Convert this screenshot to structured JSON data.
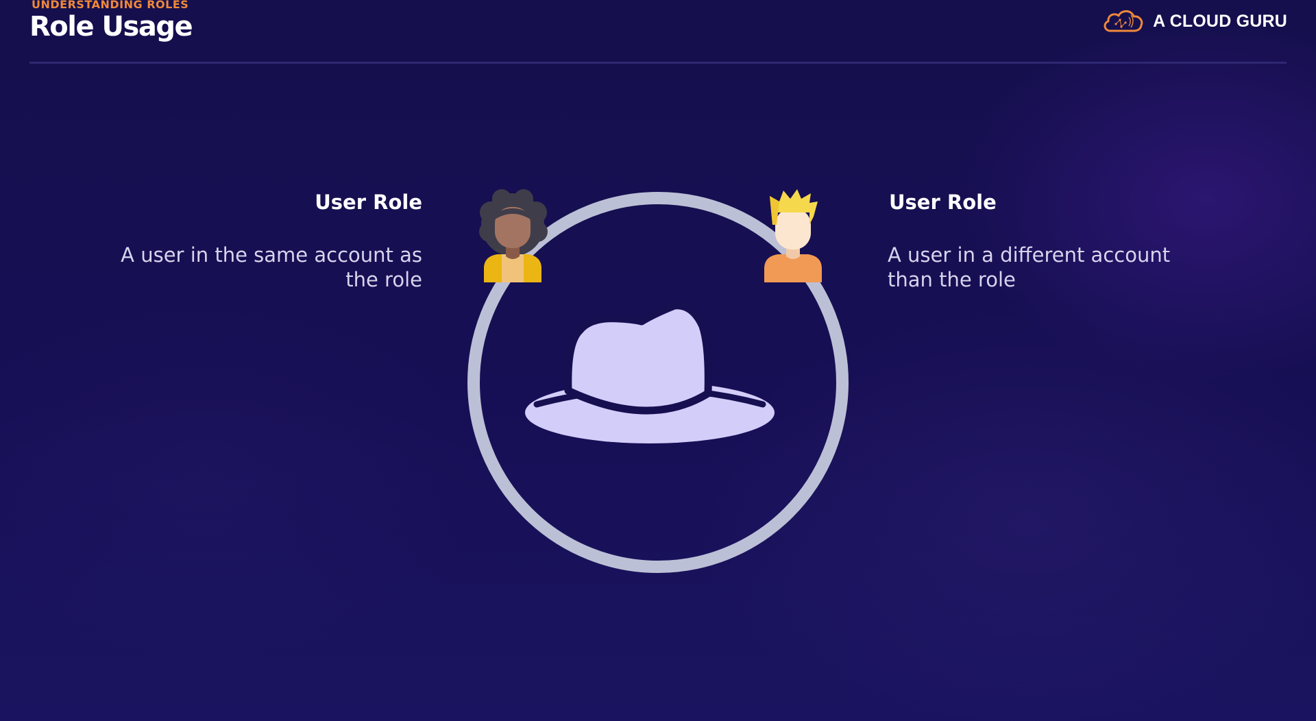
{
  "slide": {
    "section_label": "UNDERSTANDING ROLES",
    "title": "Role Usage"
  },
  "brand": {
    "name": "A CLOUD GURU",
    "logo_icon": "cloud-icon"
  },
  "left_user": {
    "heading": "User Role",
    "description": "A user in the same account as the role",
    "avatar_icon": "woman-avatar-icon"
  },
  "right_user": {
    "heading": "User Role",
    "description": "A user in a different account than the role",
    "avatar_icon": "man-avatar-icon"
  },
  "center": {
    "icon": "hat-icon"
  },
  "colors": {
    "background": "#160f50",
    "accent_orange": "#f0893a",
    "ring": "#bcc0d6",
    "hat": "#d3cdf9",
    "text_primary": "#ffffff",
    "text_secondary": "#d8d4ee"
  }
}
